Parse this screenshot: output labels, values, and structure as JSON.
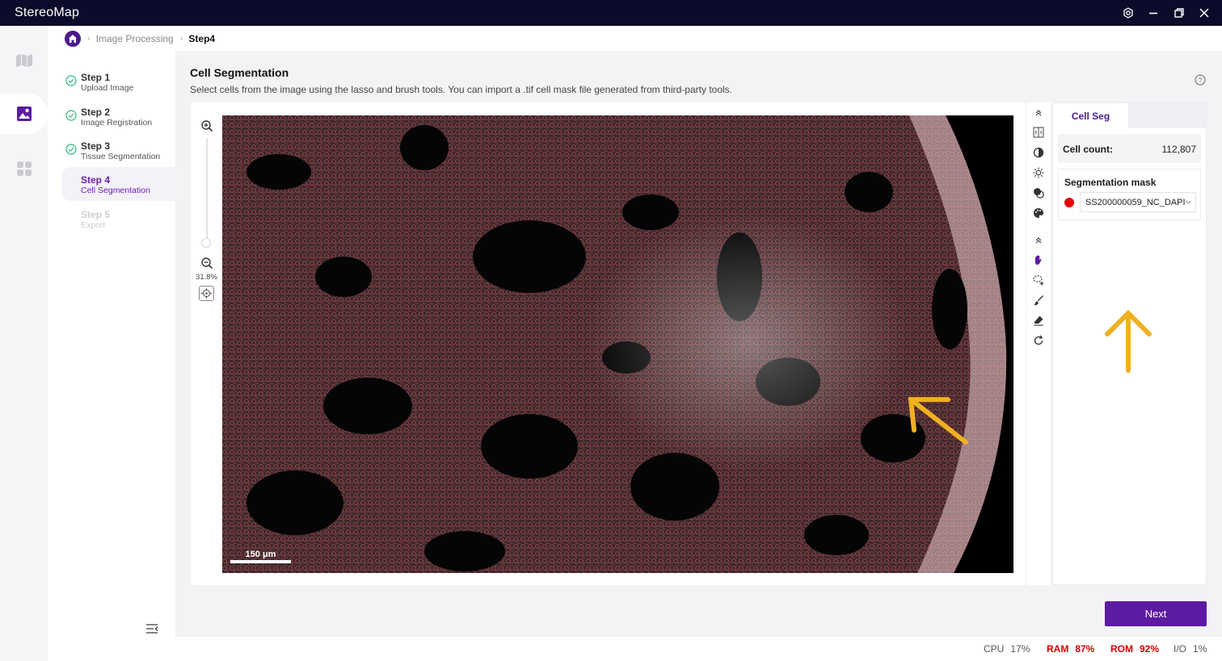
{
  "app": {
    "title": "StereoMap"
  },
  "breadcrumb": {
    "items": [
      "Image Processing",
      "Step4"
    ]
  },
  "steps": [
    {
      "title": "Step 1",
      "subtitle": "Upload Image",
      "state": "done"
    },
    {
      "title": "Step 2",
      "subtitle": "Image Registration",
      "state": "done"
    },
    {
      "title": "Step 3",
      "subtitle": "Tissue Segmentation",
      "state": "done"
    },
    {
      "title": "Step 4",
      "subtitle": "Cell Segmentation",
      "state": "active"
    },
    {
      "title": "Step 5",
      "subtitle": "Export",
      "state": "disabled"
    }
  ],
  "main": {
    "title": "Cell Segmentation",
    "description": "Select cells from the image using the lasso and brush tools. You can import a .tif cell mask file generated from third-party tools."
  },
  "viewer": {
    "zoom_level": "31.8%",
    "scalebar_label": "150 μm"
  },
  "panel": {
    "tab_label": "Cell Seg",
    "cell_count_label": "Cell count:",
    "cell_count_value": "112,807",
    "mask_label": "Segmentation mask",
    "mask_value": "SS200000059_NC_DAPI",
    "mask_color": "#e60000"
  },
  "actions": {
    "next_label": "Next"
  },
  "status": {
    "cpu_label": "CPU",
    "cpu_value": "17%",
    "ram_label": "RAM",
    "ram_value": "87%",
    "rom_label": "ROM",
    "rom_value": "92%",
    "io_label": "I/O",
    "io_value": "1%"
  },
  "icons": {
    "rail": [
      "map-icon",
      "image-processing-icon",
      "apps-icon"
    ],
    "window": [
      "settings-icon",
      "minimize-icon",
      "restore-icon",
      "close-icon"
    ],
    "tools": [
      "collapse-up-icon",
      "split-view-icon",
      "contrast-icon",
      "brightness-icon",
      "layers-icon",
      "palette-icon",
      "collapse-up-icon",
      "hand-pan-icon",
      "lasso-add-icon",
      "brush-icon",
      "eraser-icon",
      "redo-icon"
    ]
  },
  "colors": {
    "accent": "#5d1aa3",
    "titlebar": "#0d0b2b",
    "annotation_arrow": "#f0b020",
    "warning": "#d90000"
  }
}
